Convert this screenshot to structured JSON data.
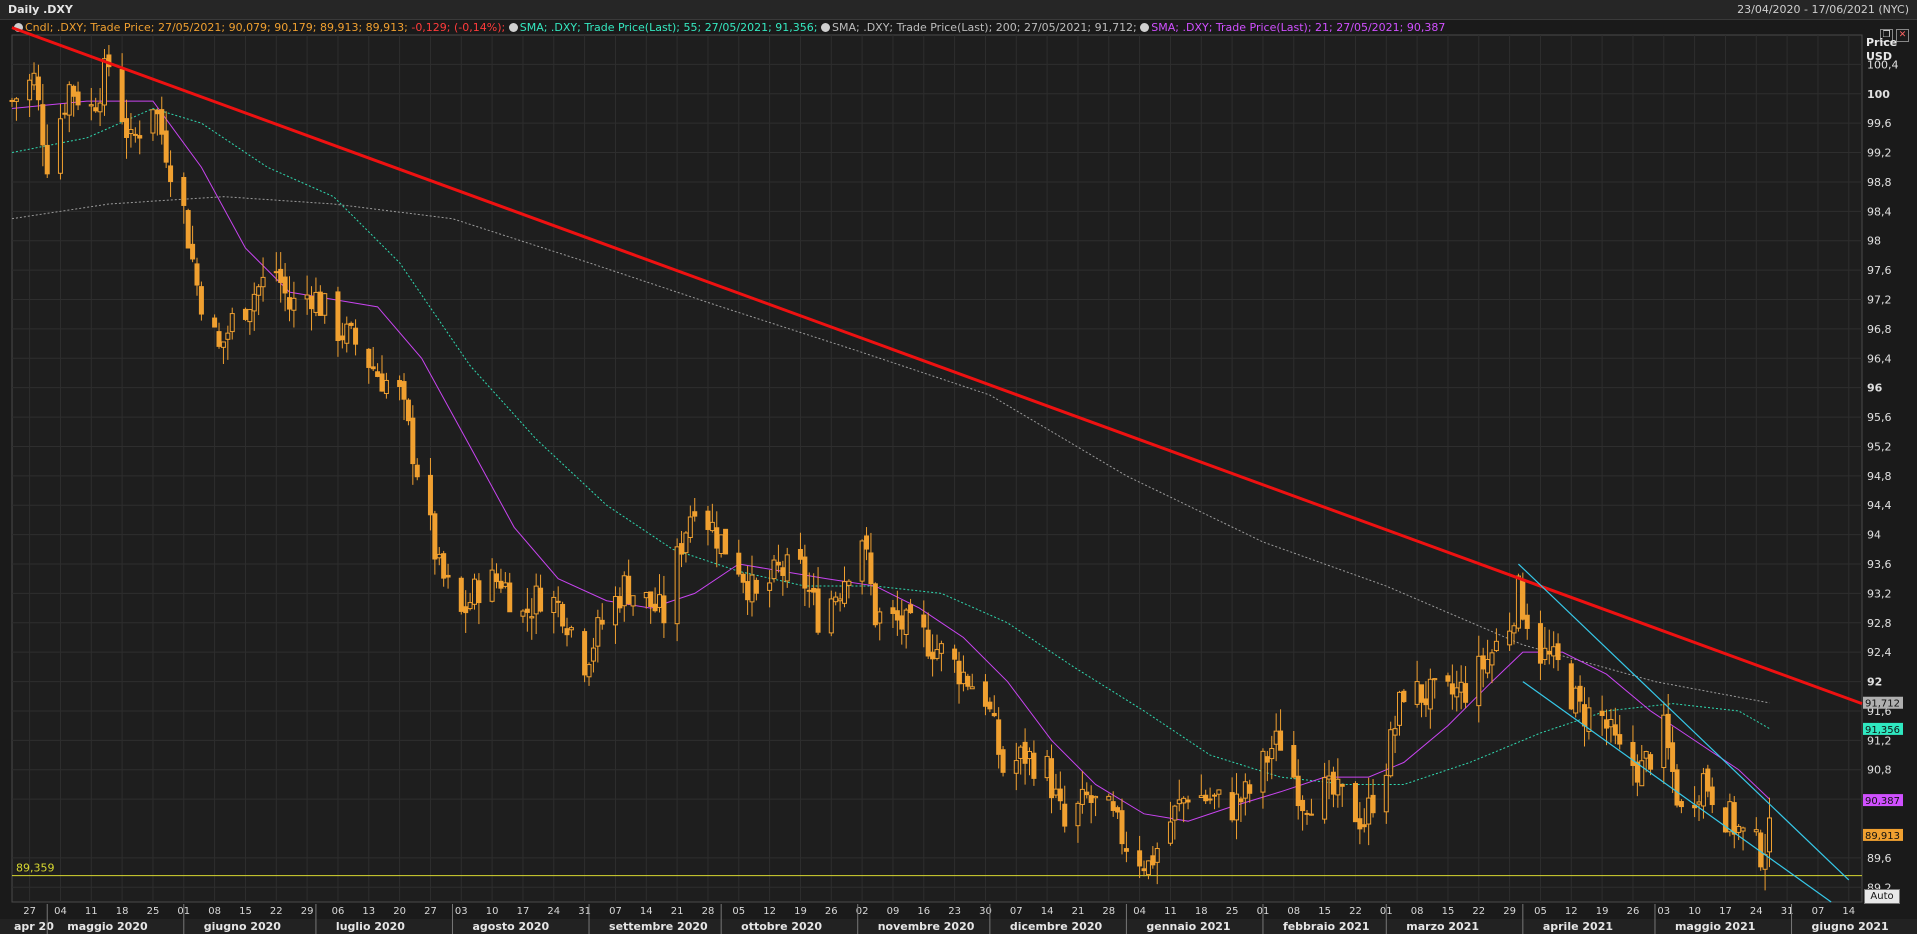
{
  "window": {
    "title": "Daily .DXY",
    "date_range": "23/04/2020 - 17/06/2021 (NYC)"
  },
  "legend": [
    {
      "text": "Cndl; .DXY; Trade Price;  27/05/2021; 90,079; 90,179; 89,913; 89,913; ",
      "color": "#f0a030"
    },
    {
      "text": "-0,129; (-0,14%);",
      "color": "#ff3b3b"
    },
    {
      "text": "SMA; .DXY; Trade Price(Last);  55; 27/05/2021; 91,356;",
      "color": "#35e8c0"
    },
    {
      "text": "SMA; .DXY; Trade Price(Last);  200; 27/05/2021; 91,712;",
      "color": "#bdbdbd"
    },
    {
      "text": "SMA; .DXY; Trade Price(Last);  21; 27/05/2021; 90,387",
      "color": "#d050ff"
    }
  ],
  "y_axis_header": [
    "Price",
    "USD"
  ],
  "auto_label": "Auto",
  "icons": [
    "restore-icon",
    "close-icon"
  ],
  "colors": {
    "candles": "#f0a030",
    "sma21": "#c844f0",
    "sma55": "#2fd9b0",
    "sma200": "#9a9a9a",
    "trendline": "#ee1111",
    "channel": "#36c8e8",
    "support": "#d8d830"
  },
  "chart_data": {
    "type": "candlestick",
    "ylim": [
      89.0,
      100.8
    ],
    "x_range": [
      "2020-04-23",
      "2021-06-17"
    ],
    "y_ticks": [
      "100,4",
      "100",
      "99,6",
      "99,2",
      "98,8",
      "98,4",
      "98",
      "97,6",
      "97,2",
      "96,8",
      "96,4",
      "96",
      "95,6",
      "95,2",
      "94,8",
      "94,4",
      "94",
      "93,6",
      "93,2",
      "92,8",
      "92,4",
      "92",
      "91,6",
      "91,2",
      "90,8",
      "90,4",
      "89,6",
      "89,2"
    ],
    "y_tick_values": [
      100.4,
      100,
      99.6,
      99.2,
      98.8,
      98.4,
      98,
      97.6,
      97.2,
      96.8,
      96.4,
      96,
      95.6,
      95.2,
      94.8,
      94.4,
      94,
      93.6,
      93.2,
      92.8,
      92.4,
      92,
      91.6,
      91.2,
      90.8,
      90.4,
      89.6,
      89.2
    ],
    "y_tick_bold": [
      false,
      true,
      false,
      false,
      false,
      false,
      false,
      false,
      false,
      false,
      false,
      true,
      false,
      false,
      false,
      false,
      false,
      false,
      false,
      false,
      false,
      true,
      false,
      false,
      false,
      false,
      false,
      false
    ],
    "x_ticks": [
      {
        "d": "2020-04-27",
        "l": "27"
      },
      {
        "d": "2020-05-04",
        "l": "04"
      },
      {
        "d": "2020-05-11",
        "l": "11"
      },
      {
        "d": "2020-05-18",
        "l": "18"
      },
      {
        "d": "2020-05-25",
        "l": "25"
      },
      {
        "d": "2020-06-01",
        "l": "01"
      },
      {
        "d": "2020-06-08",
        "l": "08"
      },
      {
        "d": "2020-06-15",
        "l": "15"
      },
      {
        "d": "2020-06-22",
        "l": "22"
      },
      {
        "d": "2020-06-29",
        "l": "29"
      },
      {
        "d": "2020-07-06",
        "l": "06"
      },
      {
        "d": "2020-07-13",
        "l": "13"
      },
      {
        "d": "2020-07-20",
        "l": "20"
      },
      {
        "d": "2020-07-27",
        "l": "27"
      },
      {
        "d": "2020-08-03",
        "l": "03"
      },
      {
        "d": "2020-08-10",
        "l": "10"
      },
      {
        "d": "2020-08-17",
        "l": "17"
      },
      {
        "d": "2020-08-24",
        "l": "24"
      },
      {
        "d": "2020-08-31",
        "l": "31"
      },
      {
        "d": "2020-09-07",
        "l": "07"
      },
      {
        "d": "2020-09-14",
        "l": "14"
      },
      {
        "d": "2020-09-21",
        "l": "21"
      },
      {
        "d": "2020-09-28",
        "l": "28"
      },
      {
        "d": "2020-10-05",
        "l": "05"
      },
      {
        "d": "2020-10-12",
        "l": "12"
      },
      {
        "d": "2020-10-19",
        "l": "19"
      },
      {
        "d": "2020-10-26",
        "l": "26"
      },
      {
        "d": "2020-11-02",
        "l": "02"
      },
      {
        "d": "2020-11-09",
        "l": "09"
      },
      {
        "d": "2020-11-16",
        "l": "16"
      },
      {
        "d": "2020-11-23",
        "l": "23"
      },
      {
        "d": "2020-11-30",
        "l": "30"
      },
      {
        "d": "2020-12-07",
        "l": "07"
      },
      {
        "d": "2020-12-14",
        "l": "14"
      },
      {
        "d": "2020-12-21",
        "l": "21"
      },
      {
        "d": "2020-12-28",
        "l": "28"
      },
      {
        "d": "2021-01-04",
        "l": "04"
      },
      {
        "d": "2021-01-11",
        "l": "11"
      },
      {
        "d": "2021-01-18",
        "l": "18"
      },
      {
        "d": "2021-01-25",
        "l": "25"
      },
      {
        "d": "2021-02-01",
        "l": "01"
      },
      {
        "d": "2021-02-08",
        "l": "08"
      },
      {
        "d": "2021-02-15",
        "l": "15"
      },
      {
        "d": "2021-02-22",
        "l": "22"
      },
      {
        "d": "2021-03-01",
        "l": "01"
      },
      {
        "d": "2021-03-08",
        "l": "08"
      },
      {
        "d": "2021-03-15",
        "l": "15"
      },
      {
        "d": "2021-03-22",
        "l": "22"
      },
      {
        "d": "2021-03-29",
        "l": "29"
      },
      {
        "d": "2021-04-05",
        "l": "05"
      },
      {
        "d": "2021-04-12",
        "l": "12"
      },
      {
        "d": "2021-04-19",
        "l": "19"
      },
      {
        "d": "2021-04-26",
        "l": "26"
      },
      {
        "d": "2021-05-03",
        "l": "03"
      },
      {
        "d": "2021-05-10",
        "l": "10"
      },
      {
        "d": "2021-05-17",
        "l": "17"
      },
      {
        "d": "2021-05-24",
        "l": "24"
      },
      {
        "d": "2021-05-31",
        "l": "31"
      },
      {
        "d": "2021-06-07",
        "l": "07"
      },
      {
        "d": "2021-06-14",
        "l": "14"
      }
    ],
    "month_labels": [
      {
        "d": "2020-04-23",
        "l": "apr 20"
      },
      {
        "d": "2020-05-01",
        "l": "maggio 2020"
      },
      {
        "d": "2020-06-01",
        "l": "giugno 2020"
      },
      {
        "d": "2020-07-01",
        "l": "luglio 2020"
      },
      {
        "d": "2020-08-01",
        "l": "agosto 2020"
      },
      {
        "d": "2020-09-01",
        "l": "settembre 2020"
      },
      {
        "d": "2020-10-01",
        "l": "ottobre 2020"
      },
      {
        "d": "2020-11-01",
        "l": "novembre 2020"
      },
      {
        "d": "2020-12-01",
        "l": "dicembre 2020"
      },
      {
        "d": "2021-01-01",
        "l": "gennaio 2021"
      },
      {
        "d": "2021-02-01",
        "l": "febbraio 2021"
      },
      {
        "d": "2021-03-01",
        "l": "marzo 2021"
      },
      {
        "d": "2021-04-01",
        "l": "aprile 2021"
      },
      {
        "d": "2021-05-01",
        "l": "maggio 2021"
      },
      {
        "d": "2021-06-01",
        "l": "giugno 2021"
      }
    ],
    "price_path": [
      [
        "2020-04-23",
        99.9
      ],
      [
        "2020-04-28",
        100.2
      ],
      [
        "2020-05-01",
        99.1
      ],
      [
        "2020-05-06",
        100.1
      ],
      [
        "2020-05-11",
        99.8
      ],
      [
        "2020-05-15",
        100.4
      ],
      [
        "2020-05-20",
        99.3
      ],
      [
        "2020-05-25",
        99.9
      ],
      [
        "2020-06-01",
        98.4
      ],
      [
        "2020-06-04",
        97.4
      ],
      [
        "2020-06-09",
        96.5
      ],
      [
        "2020-06-12",
        96.9
      ],
      [
        "2020-06-17",
        97.3
      ],
      [
        "2020-06-22",
        97.6
      ],
      [
        "2020-06-25",
        97.1
      ],
      [
        "2020-06-30",
        97.3
      ],
      [
        "2020-07-06",
        96.8
      ],
      [
        "2020-07-10",
        96.6
      ],
      [
        "2020-07-15",
        96.2
      ],
      [
        "2020-07-20",
        95.9
      ],
      [
        "2020-07-24",
        94.9
      ],
      [
        "2020-07-29",
        93.5
      ],
      [
        "2020-08-03",
        92.9
      ],
      [
        "2020-08-07",
        93.3
      ],
      [
        "2020-08-12",
        93.4
      ],
      [
        "2020-08-17",
        92.9
      ],
      [
        "2020-08-21",
        93.2
      ],
      [
        "2020-08-26",
        93.0
      ],
      [
        "2020-08-31",
        92.3
      ],
      [
        "2020-09-04",
        92.8
      ],
      [
        "2020-09-09",
        93.3
      ],
      [
        "2020-09-14",
        93.1
      ],
      [
        "2020-09-18",
        92.9
      ],
      [
        "2020-09-22",
        93.9
      ],
      [
        "2020-09-25",
        94.5
      ],
      [
        "2020-09-30",
        94.0
      ],
      [
        "2020-10-05",
        93.6
      ],
      [
        "2020-10-09",
        93.1
      ],
      [
        "2020-10-14",
        93.5
      ],
      [
        "2020-10-19",
        93.5
      ],
      [
        "2020-10-23",
        92.9
      ],
      [
        "2020-10-28",
        93.3
      ],
      [
        "2020-11-02",
        94.0
      ],
      [
        "2020-11-05",
        92.9
      ],
      [
        "2020-11-10",
        92.8
      ],
      [
        "2020-11-16",
        92.6
      ],
      [
        "2020-11-20",
        92.4
      ],
      [
        "2020-11-25",
        92.1
      ],
      [
        "2020-11-30",
        91.8
      ],
      [
        "2020-12-04",
        90.8
      ],
      [
        "2020-12-09",
        91.0
      ],
      [
        "2020-12-14",
        90.8
      ],
      [
        "2020-12-18",
        90.0
      ],
      [
        "2020-12-23",
        90.4
      ],
      [
        "2020-12-28",
        90.2
      ],
      [
        "2021-01-01",
        89.8
      ],
      [
        "2021-01-06",
        89.5
      ],
      [
        "2021-01-11",
        90.1
      ],
      [
        "2021-01-15",
        90.5
      ],
      [
        "2021-01-20",
        90.4
      ],
      [
        "2021-01-25",
        90.3
      ],
      [
        "2021-01-29",
        90.5
      ],
      [
        "2021-02-03",
        91.1
      ],
      [
        "2021-02-05",
        91.2
      ],
      [
        "2021-02-10",
        90.4
      ],
      [
        "2021-02-15",
        90.5
      ],
      [
        "2021-02-19",
        90.4
      ],
      [
        "2021-02-24",
        90.1
      ],
      [
        "2021-03-01",
        90.9
      ],
      [
        "2021-03-05",
        91.9
      ],
      [
        "2021-03-10",
        91.8
      ],
      [
        "2021-03-15",
        91.8
      ],
      [
        "2021-03-19",
        91.9
      ],
      [
        "2021-03-24",
        92.3
      ],
      [
        "2021-03-29",
        92.8
      ],
      [
        "2021-03-31",
        93.2
      ],
      [
        "2021-04-05",
        92.4
      ],
      [
        "2021-04-09",
        92.2
      ],
      [
        "2021-04-14",
        91.6
      ],
      [
        "2021-04-19",
        91.5
      ],
      [
        "2021-04-23",
        91.0
      ],
      [
        "2021-04-28",
        90.8
      ],
      [
        "2021-05-03",
        91.3
      ],
      [
        "2021-05-07",
        90.2
      ],
      [
        "2021-05-12",
        90.7
      ],
      [
        "2021-05-17",
        90.2
      ],
      [
        "2021-05-21",
        89.9
      ],
      [
        "2021-05-25",
        89.7
      ],
      [
        "2021-05-27",
        89.9
      ]
    ],
    "sma21": [
      [
        "2020-04-23",
        99.8
      ],
      [
        "2020-05-10",
        99.9
      ],
      [
        "2020-05-25",
        99.9
      ],
      [
        "2020-06-05",
        99.0
      ],
      [
        "2020-06-15",
        97.9
      ],
      [
        "2020-06-25",
        97.3
      ],
      [
        "2020-07-05",
        97.2
      ],
      [
        "2020-07-15",
        97.1
      ],
      [
        "2020-07-25",
        96.4
      ],
      [
        "2020-08-05",
        95.2
      ],
      [
        "2020-08-15",
        94.1
      ],
      [
        "2020-08-25",
        93.4
      ],
      [
        "2020-09-05",
        93.1
      ],
      [
        "2020-09-15",
        93.0
      ],
      [
        "2020-09-25",
        93.2
      ],
      [
        "2020-10-05",
        93.6
      ],
      [
        "2020-10-15",
        93.5
      ],
      [
        "2020-10-25",
        93.4
      ],
      [
        "2020-11-05",
        93.3
      ],
      [
        "2020-11-15",
        93.0
      ],
      [
        "2020-11-25",
        92.6
      ],
      [
        "2020-12-05",
        92.0
      ],
      [
        "2020-12-15",
        91.2
      ],
      [
        "2020-12-25",
        90.6
      ],
      [
        "2021-01-05",
        90.2
      ],
      [
        "2021-01-15",
        90.1
      ],
      [
        "2021-01-25",
        90.3
      ],
      [
        "2021-02-05",
        90.5
      ],
      [
        "2021-02-15",
        90.7
      ],
      [
        "2021-02-25",
        90.7
      ],
      [
        "2021-03-05",
        90.9
      ],
      [
        "2021-03-15",
        91.4
      ],
      [
        "2021-03-25",
        92.0
      ],
      [
        "2021-04-01",
        92.4
      ],
      [
        "2021-04-10",
        92.4
      ],
      [
        "2021-04-20",
        92.1
      ],
      [
        "2021-04-30",
        91.6
      ],
      [
        "2021-05-10",
        91.2
      ],
      [
        "2021-05-20",
        90.8
      ],
      [
        "2021-05-27",
        90.4
      ]
    ],
    "sma55": [
      [
        "2020-04-23",
        99.2
      ],
      [
        "2020-05-10",
        99.4
      ],
      [
        "2020-05-25",
        99.8
      ],
      [
        "2020-06-05",
        99.6
      ],
      [
        "2020-06-20",
        99.0
      ],
      [
        "2020-07-05",
        98.6
      ],
      [
        "2020-07-20",
        97.7
      ],
      [
        "2020-08-05",
        96.3
      ],
      [
        "2020-08-20",
        95.3
      ],
      [
        "2020-09-05",
        94.4
      ],
      [
        "2020-09-20",
        93.8
      ],
      [
        "2020-10-05",
        93.5
      ],
      [
        "2020-10-20",
        93.3
      ],
      [
        "2020-11-05",
        93.3
      ],
      [
        "2020-11-20",
        93.2
      ],
      [
        "2020-12-05",
        92.8
      ],
      [
        "2020-12-20",
        92.2
      ],
      [
        "2021-01-05",
        91.6
      ],
      [
        "2021-01-20",
        91.0
      ],
      [
        "2021-02-05",
        90.7
      ],
      [
        "2021-02-20",
        90.6
      ],
      [
        "2021-03-05",
        90.6
      ],
      [
        "2021-03-20",
        90.9
      ],
      [
        "2021-04-05",
        91.3
      ],
      [
        "2021-04-20",
        91.6
      ],
      [
        "2021-05-05",
        91.7
      ],
      [
        "2021-05-20",
        91.6
      ],
      [
        "2021-05-27",
        91.36
      ]
    ],
    "sma200": [
      [
        "2020-04-23",
        98.3
      ],
      [
        "2020-05-15",
        98.5
      ],
      [
        "2020-06-10",
        98.6
      ],
      [
        "2020-07-05",
        98.5
      ],
      [
        "2020-08-01",
        98.3
      ],
      [
        "2020-09-01",
        97.7
      ],
      [
        "2020-10-01",
        97.1
      ],
      [
        "2020-11-01",
        96.5
      ],
      [
        "2020-12-01",
        95.9
      ],
      [
        "2021-01-01",
        94.8
      ],
      [
        "2021-02-01",
        93.9
      ],
      [
        "2021-03-01",
        93.3
      ],
      [
        "2021-04-01",
        92.5
      ],
      [
        "2021-05-01",
        92.0
      ],
      [
        "2021-05-27",
        91.71
      ]
    ],
    "trendline": {
      "from": [
        "2020-04-23",
        100.9
      ],
      "to": [
        "2021-06-17",
        91.7
      ]
    },
    "channel_upper": {
      "from": [
        "2021-03-31",
        93.6
      ],
      "to": [
        "2021-06-14",
        89.3
      ]
    },
    "channel_lower": {
      "from": [
        "2021-04-01",
        92.0
      ],
      "to": [
        "2021-06-10",
        89.0
      ]
    },
    "support_line": {
      "value": 89.359,
      "label": "89,359"
    },
    "last_value_tags": [
      {
        "label": "91,712",
        "value": 91.712,
        "bg": "#b0b0b0",
        "fg": "#111111"
      },
      {
        "label": "91,356",
        "value": 91.356,
        "bg": "#2fe8c0",
        "fg": "#111111"
      },
      {
        "label": "90,387",
        "value": 90.387,
        "bg": "#d050ff",
        "fg": "#111111"
      },
      {
        "label": "89,913",
        "value": 89.913,
        "bg": "#f0a030",
        "fg": "#111111"
      }
    ]
  }
}
